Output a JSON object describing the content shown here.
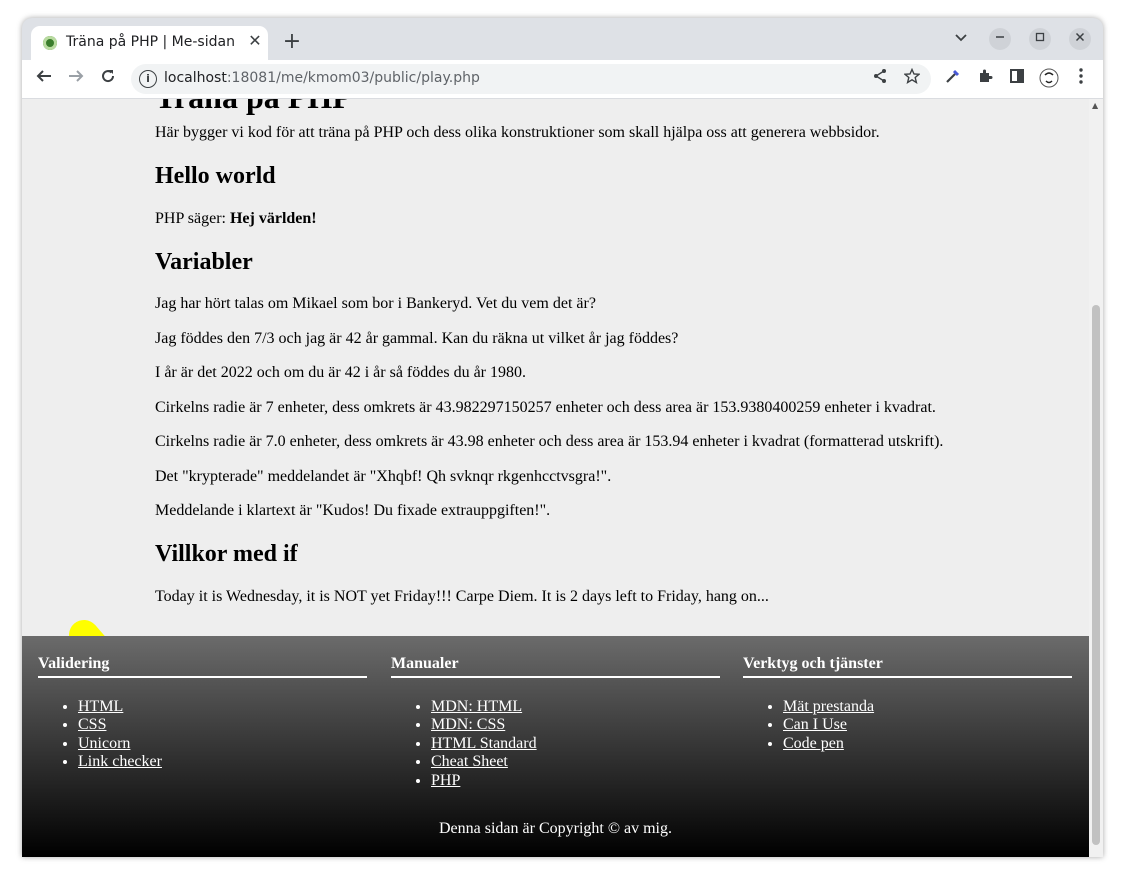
{
  "browser": {
    "tab_title": "Träna på PHP | Me-sidan",
    "tab_close": "✕",
    "new_tab": "+",
    "url_host": "localhost",
    "url_path": ":18081/me/kmom03/public/play.php"
  },
  "page": {
    "h1": "Träna på PHP",
    "intro": "Här bygger vi kod för att träna på PHP och dess olika konstruktioner som skall hjälpa oss att generera webbsidor.",
    "hello_heading": "Hello world",
    "hello_prefix": "PHP säger: ",
    "hello_strong": "Hej världen!",
    "variables_heading": "Variabler",
    "variables_paragraphs": [
      "Jag har hört talas om Mikael som bor i Bankeryd. Vet du vem det är?",
      "Jag föddes den 7/3 och jag är 42 år gammal. Kan du räkna ut vilket år jag föddes?",
      "I år är det 2022 och om du är 42 i år så föddes du år 1980.",
      "Cirkelns radie är 7 enheter, dess omkrets är 43.982297150257 enheter och dess area är 153.9380400259 enheter i kvadrat.",
      "Cirkelns radie är 7.0 enheter, dess omkrets är 43.98 enheter och dess area är 153.94 enheter i kvadrat (formatterad utskrift).",
      "Det \"krypterade\" meddelandet är \"Xhqbf! Qh svknqr rkgenhcctvsgra!\".",
      "Meddelande i klartext är \"Kudos! Du fixade extrauppgiften!\"."
    ],
    "if_heading": "Villkor med if",
    "if_text": "Today it is Wednesday, it is NOT yet Friday!!! Carpe Diem. It is 2 days left to Friday, hang on..."
  },
  "footer": {
    "columns": [
      {
        "heading": "Validering",
        "links": [
          "HTML",
          "CSS",
          "Unicorn",
          "Link checker"
        ]
      },
      {
        "heading": "Manualer",
        "links": [
          "MDN: HTML",
          "MDN: CSS",
          "HTML Standard",
          "Cheat Sheet",
          "PHP"
        ]
      },
      {
        "heading": "Verktyg och tjänster",
        "links": [
          "Mät prestanda",
          "Can I Use",
          "Code pen"
        ]
      }
    ],
    "copyright": "Denna sidan är Copyright © av mig."
  },
  "colors": {
    "page_bg": "#eeeeee",
    "footer_top": "#6b6b6b",
    "footer_bottom": "#000000",
    "annotation_yellow": "#ffff00"
  }
}
